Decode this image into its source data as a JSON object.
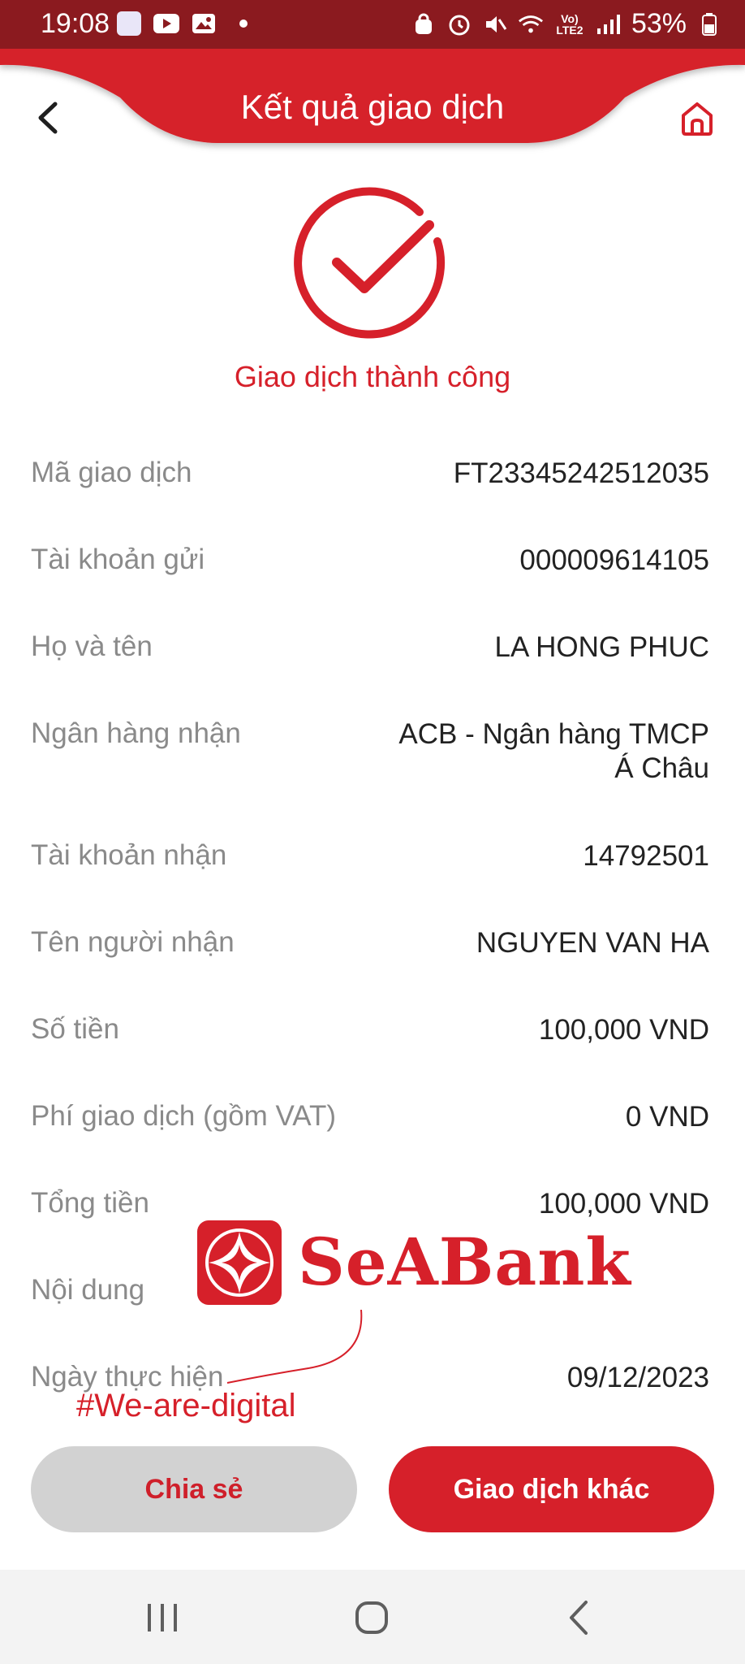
{
  "status_bar": {
    "time": "19:08",
    "battery": "53%",
    "network_badge": "Vo) LTE2"
  },
  "header": {
    "title": "Kết quả giao dịch"
  },
  "result": {
    "status_text": "Giao dịch thành công"
  },
  "details": [
    {
      "label": "Mã giao dịch",
      "value": "FT23345242512035"
    },
    {
      "label": "Tài khoản gửi",
      "value": "000009614105"
    },
    {
      "label": "Họ và tên",
      "value": "LA HONG PHUC"
    },
    {
      "label": "Ngân hàng nhận",
      "value": "ACB - Ngân hàng TMCP",
      "value_line2": "Á Châu"
    },
    {
      "label": "Tài khoản nhận",
      "value": "14792501"
    },
    {
      "label": "Tên người nhận",
      "value": "NGUYEN VAN HA"
    },
    {
      "label": "Số tiền",
      "value": "100,000 VND"
    },
    {
      "label": "Phí giao dịch (gồm VAT)",
      "value": "0 VND"
    },
    {
      "label": "Tổng tiền",
      "value": "100,000 VND"
    },
    {
      "label": "Nội dung",
      "value": ""
    },
    {
      "label": "Ngày thực hiện",
      "value": "09/12/2023"
    }
  ],
  "watermark": {
    "brand": "SeABank",
    "tagline": "#We-are-digital"
  },
  "actions": {
    "share_label": "Chia sẻ",
    "other_label": "Giao dịch khác"
  },
  "colors": {
    "brand_red": "#d6202a",
    "status_bar": "#8b1a1f",
    "label_gray": "#8a8a8a"
  }
}
